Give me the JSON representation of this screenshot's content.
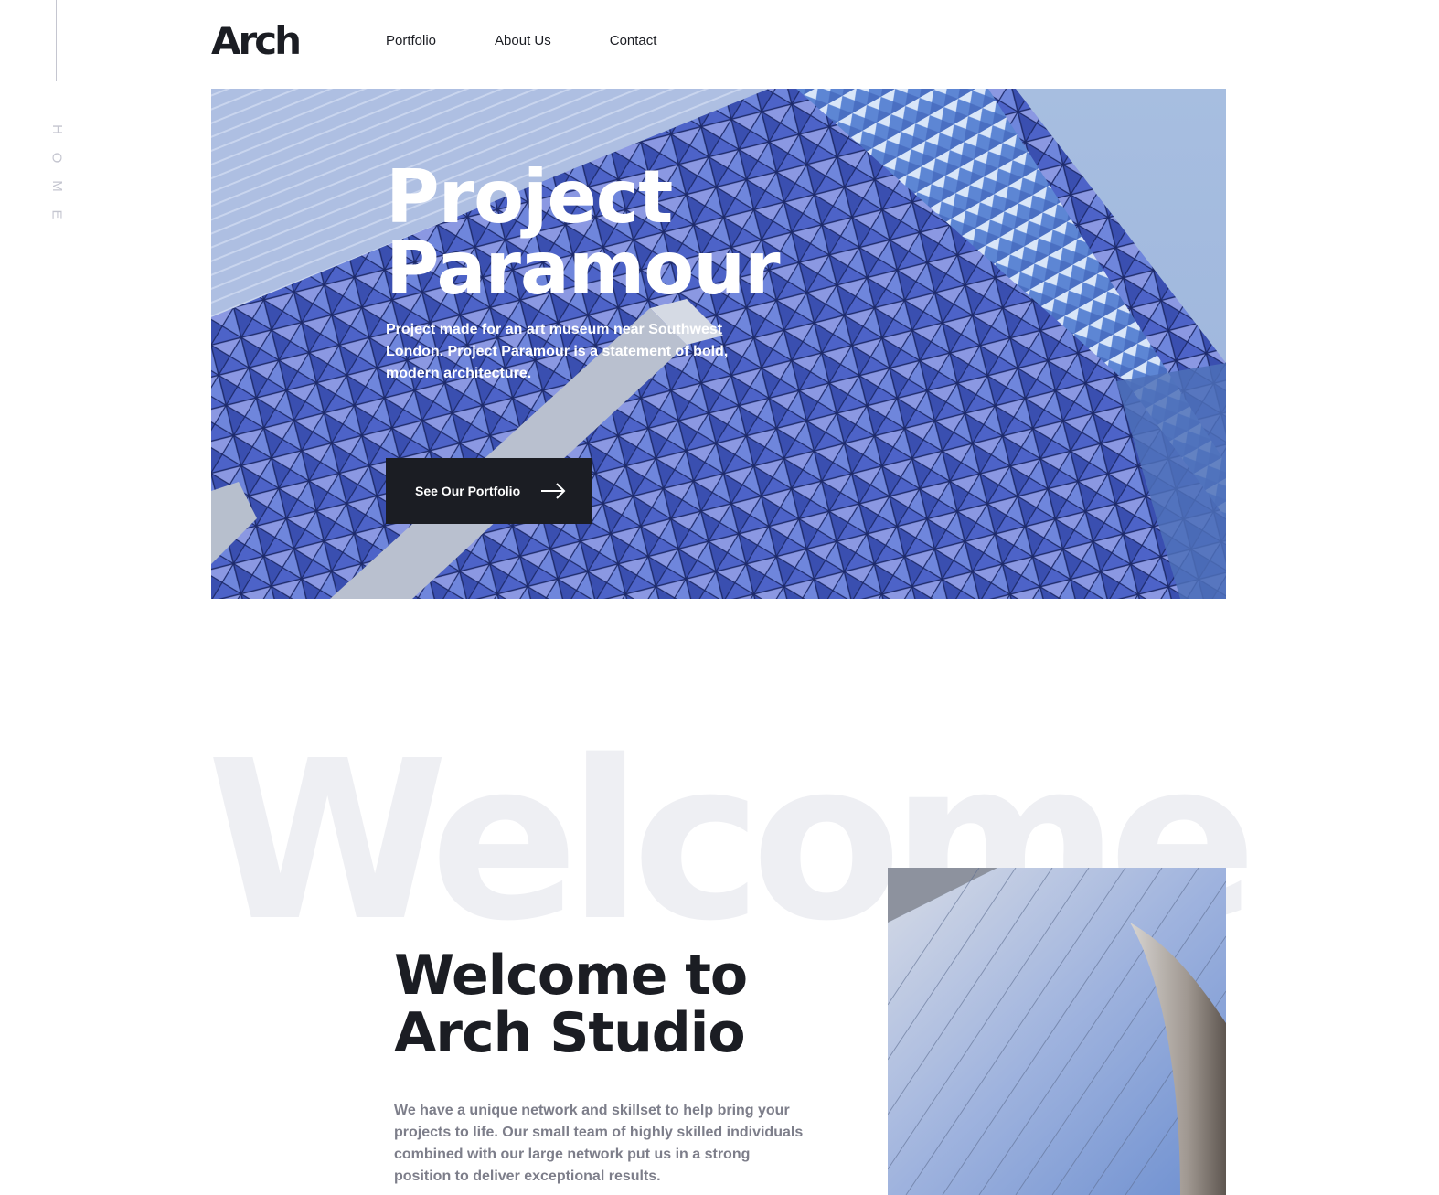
{
  "side": {
    "page_label": "HOME",
    "letters": [
      "H",
      "O",
      "M",
      "E"
    ]
  },
  "header": {
    "logo": "Arch",
    "nav": [
      {
        "label": "Portfolio"
      },
      {
        "label": "About Us"
      },
      {
        "label": "Contact"
      }
    ]
  },
  "hero": {
    "title_line1": "Project",
    "title_line2": "Paramour",
    "description": "Project made for an art museum near Southwest London. Project Paramour is a statement of bold, modern architecture.",
    "cta_label": "See Our Portfolio"
  },
  "welcome": {
    "watermark": "Welcome",
    "title_line1": "Welcome to",
    "title_line2": "Arch Studio",
    "body": "We have a unique network and skillset to help bring your projects to life. Our small team of highly skilled individuals combined with our large network put us in a strong position to deliver exceptional results."
  },
  "colors": {
    "dark": "#1b1d23",
    "muted": "#7d7e8a",
    "light_grey": "#eeeff3",
    "rail": "#c5c6d0"
  }
}
